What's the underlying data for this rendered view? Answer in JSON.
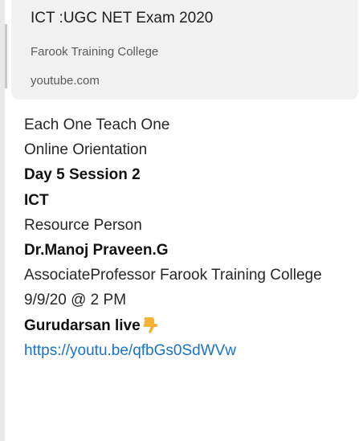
{
  "preview": {
    "title": "ICT :UGC NET Exam 2020",
    "subtitle": "Farook Training College",
    "domain": "youtube.com"
  },
  "message": {
    "line1": "Each One Teach One",
    "line2": "Online Orientation",
    "line3": "Day 5 Session 2",
    "line4": "ICT",
    "line5": "Resource Person",
    "line6": "Dr.Manoj Praveen.G",
    "line7": "AssociateProfessor Farook Training College",
    "line8": "9/9/20 @ 2 PM",
    "line9": "Gurudarsan live",
    "link": "https://youtu.be/qfbGs0SdWVw"
  },
  "icons": {
    "pointer": "pointing-down-hand-icon"
  },
  "colors": {
    "link": "#1a73c9",
    "preview_bg": "#f1f1f1",
    "emoji": "#f5b335"
  }
}
